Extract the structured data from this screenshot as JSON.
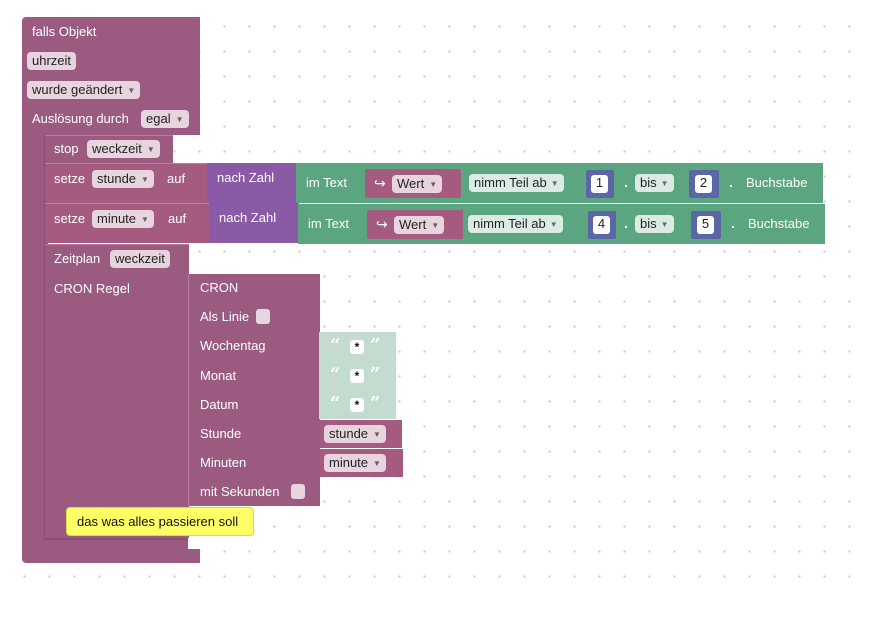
{
  "event_block": {
    "label": "falls Objekt",
    "object_id": "uhrzeit",
    "condition": "wurde geändert",
    "trigger_label": "Auslösung durch",
    "trigger_value": "egal"
  },
  "stop_block": {
    "label": "stop",
    "value": "weckzeit"
  },
  "set_blocks": [
    {
      "label": "setze",
      "variable": "stunde",
      "to": "auf",
      "convert": "nach Zahl",
      "in_text": "im Text",
      "value_label": "Wert",
      "op": "nimm Teil ab",
      "from": "1",
      "to_label": "bis",
      "to_value": "2",
      "suffix": "Buchstabe"
    },
    {
      "label": "setze",
      "variable": "minute",
      "to": "auf",
      "convert": "nach Zahl",
      "in_text": "im Text",
      "value_label": "Wert",
      "op": "nimm Teil ab",
      "from": "4",
      "to_label": "bis",
      "to_value": "5",
      "suffix": "Buchstabe"
    }
  ],
  "schedule_block": {
    "label": "Zeitplan",
    "name": "weckzeit",
    "cron_label": "CRON Regel",
    "cron_title": "CRON",
    "as_line": "Als Linie",
    "weekday": "Wochentag",
    "month": "Monat",
    "date": "Datum",
    "hour": "Stunde",
    "minutes": "Minuten",
    "seconds": "mit Sekunden",
    "star": "*",
    "open_quote": "“",
    "close_quote": "”",
    "hour_var": "stunde",
    "minute_var": "minute"
  },
  "comment": "das was alles passieren soll",
  "colors": {
    "event": "#9b5b81",
    "variable": "#a55b80",
    "convert": "#8b5aa6",
    "text": "#5ba580",
    "number": "#5b67a5",
    "string": "#c3dccf",
    "comment": "#ffff66"
  }
}
